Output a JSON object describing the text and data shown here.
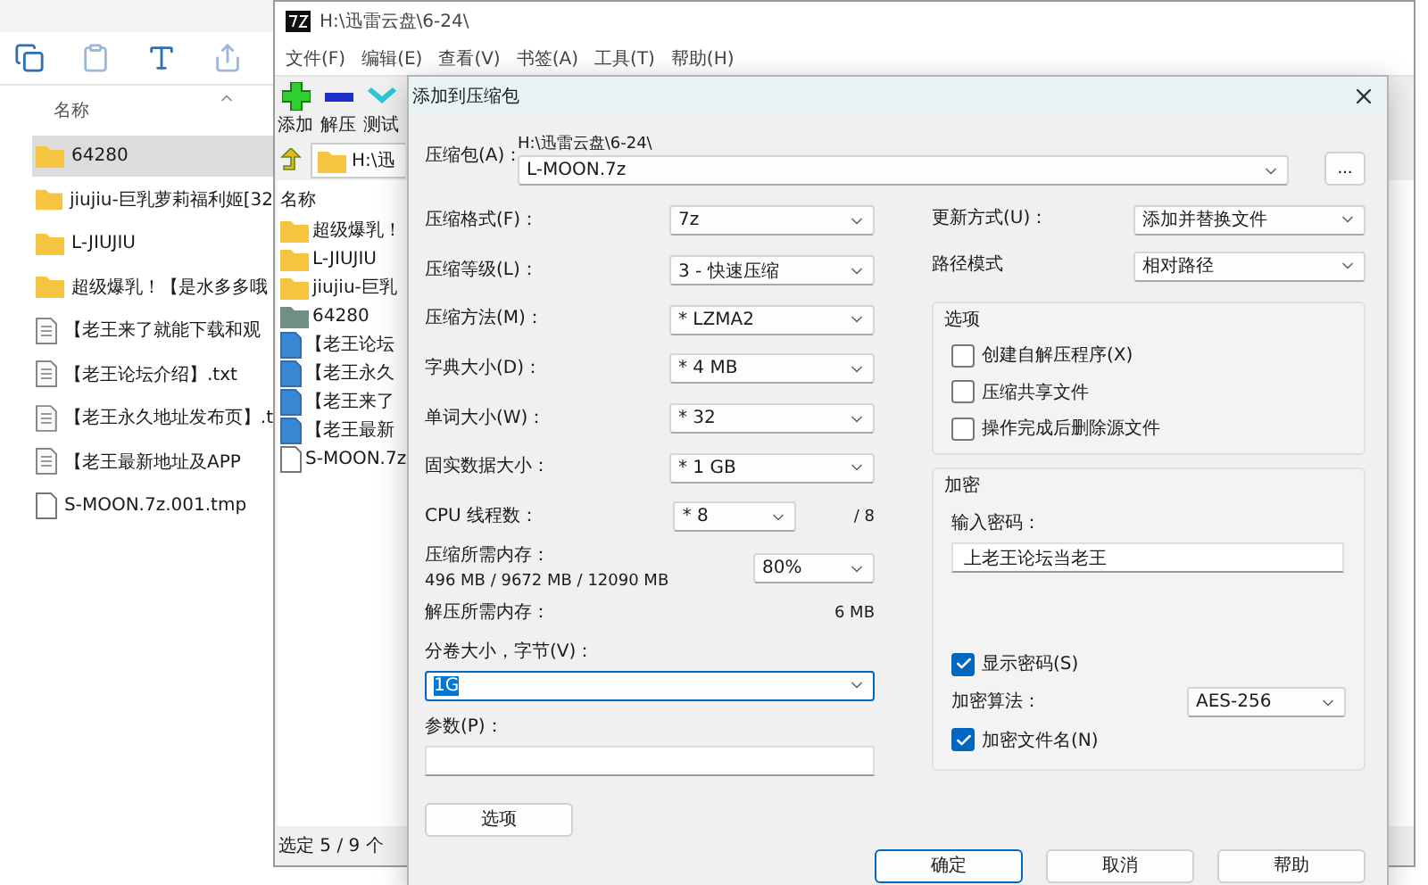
{
  "explorer": {
    "column": "名称",
    "items": [
      {
        "name": "64280",
        "kind": "folder",
        "selected": true
      },
      {
        "name": "jiujiu-巨乳萝莉福利姬[32",
        "kind": "folder",
        "selected": false
      },
      {
        "name": "L-JIUJIU",
        "kind": "folder",
        "selected": false
      },
      {
        "name": "超级爆乳！【是水多多哦",
        "kind": "folder",
        "selected": false
      },
      {
        "name": "【老王来了就能下载和观",
        "kind": "text",
        "selected": false
      },
      {
        "name": "【老王论坛介绍】.txt",
        "kind": "text",
        "selected": false
      },
      {
        "name": "【老王永久地址发布页】.t",
        "kind": "text",
        "selected": false
      },
      {
        "name": "【老王最新地址及APP",
        "kind": "text",
        "selected": false
      },
      {
        "name": "S-MOON.7z.001.tmp",
        "kind": "file",
        "selected": false
      }
    ]
  },
  "sevenzip": {
    "title": "H:\\迅雷云盘\\6-24\\",
    "menu": [
      "文件(F)",
      "编辑(E)",
      "查看(V)",
      "书签(A)",
      "工具(T)",
      "帮助(H)"
    ],
    "toolbar": [
      {
        "label": "添加",
        "kind": "add"
      },
      {
        "label": "解压",
        "kind": "extract"
      },
      {
        "label": "测试",
        "kind": "test"
      }
    ],
    "address": "H:\\迅",
    "column": "名称",
    "items": [
      {
        "name": "超级爆乳！",
        "kind": "folder"
      },
      {
        "name": "L-JIUJIU",
        "kind": "folder"
      },
      {
        "name": "jiujiu-巨乳",
        "kind": "folder"
      },
      {
        "name": "64280",
        "kind": "archive"
      },
      {
        "name": "【老王论坛",
        "kind": "doc"
      },
      {
        "name": "【老王永久",
        "kind": "doc"
      },
      {
        "name": "【老王来了",
        "kind": "doc"
      },
      {
        "name": "【老王最新",
        "kind": "doc"
      },
      {
        "name": "S-MOON.7z",
        "kind": "file"
      }
    ],
    "status": "选定 5 / 9 个"
  },
  "dialog": {
    "title": "添加到压缩包",
    "archive": {
      "label": "压缩包(A)：",
      "path": "H:\\迅雷云盘\\6-24\\",
      "value": "L-MOON.7z",
      "browse": "..."
    },
    "left_rows": [
      {
        "label": "压缩格式(F)：",
        "value": "7z"
      },
      {
        "label": "压缩等级(L)：",
        "value": "3 - 快速压缩"
      },
      {
        "label": "压缩方法(M)：",
        "value": "* LZMA2"
      },
      {
        "label": "字典大小(D)：",
        "value": "* 4 MB"
      },
      {
        "label": "单词大小(W)：",
        "value": "* 32"
      },
      {
        "label": "固实数据大小：",
        "value": "* 1 GB"
      }
    ],
    "cpu": {
      "label": "CPU 线程数：",
      "value": "* 8",
      "max": "/ 8"
    },
    "memory": {
      "label": "压缩所需内存：",
      "detail": "496 MB / 9672 MB / 12090 MB",
      "value": "80%"
    },
    "decompress": {
      "label": "解压所需内存：",
      "value": "6 MB"
    },
    "volume": {
      "label": "分卷大小，字节(V)：",
      "value": "1G",
      "text_selected": true
    },
    "params": {
      "label": "参数(P)："
    },
    "options_button": "选项",
    "update": {
      "label": "更新方式(U)：",
      "value": "添加并替换文件"
    },
    "path_mode": {
      "label": "路径模式",
      "value": "相对路径"
    },
    "options": {
      "title": "选项",
      "checks": [
        {
          "label": "创建自解压程序(X)",
          "checked": false
        },
        {
          "label": "压缩共享文件",
          "checked": false
        },
        {
          "label": "操作完成后删除源文件",
          "checked": false
        }
      ]
    },
    "encryption": {
      "title": "加密",
      "password_label": "输入密码：",
      "password": "上老王论坛当老王",
      "show_password": {
        "label": "显示密码(S)",
        "checked": true
      },
      "method": {
        "label": "加密算法：",
        "value": "AES-256"
      },
      "encrypt_names": {
        "label": "加密文件名(N)",
        "checked": true
      }
    },
    "buttons": [
      {
        "label": "确定",
        "default": true
      },
      {
        "label": "取消",
        "default": false
      },
      {
        "label": "帮助",
        "default": false
      }
    ]
  }
}
